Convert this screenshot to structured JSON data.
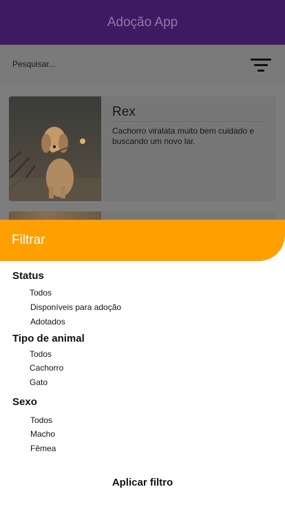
{
  "app": {
    "title": "Adoção App"
  },
  "search": {
    "placeholder": "Pesquisar...",
    "value": ""
  },
  "filter_button": {
    "icon": "filter-icon"
  },
  "pets": [
    {
      "name": "Rex",
      "description": "Cachorro viralata muito bem cuidado e buscando um novo lar."
    }
  ],
  "filter_sheet": {
    "title": "Filtrar",
    "sections": [
      {
        "title": "Status",
        "options": [
          "Todos",
          "Disponíveis para adoção",
          "Adotados"
        ]
      },
      {
        "title": "Tipo de animal",
        "options": [
          "Todos",
          "Cachorro",
          "Gato"
        ]
      },
      {
        "title": "Sexo",
        "options": [
          "Todos",
          "Macho",
          "Fêmea"
        ]
      }
    ],
    "apply_label": "Aplicar filtro"
  },
  "colors": {
    "appbar": "#3f1a63",
    "sheet_header": "#ffa000",
    "overlay": "#7c7c7c"
  }
}
